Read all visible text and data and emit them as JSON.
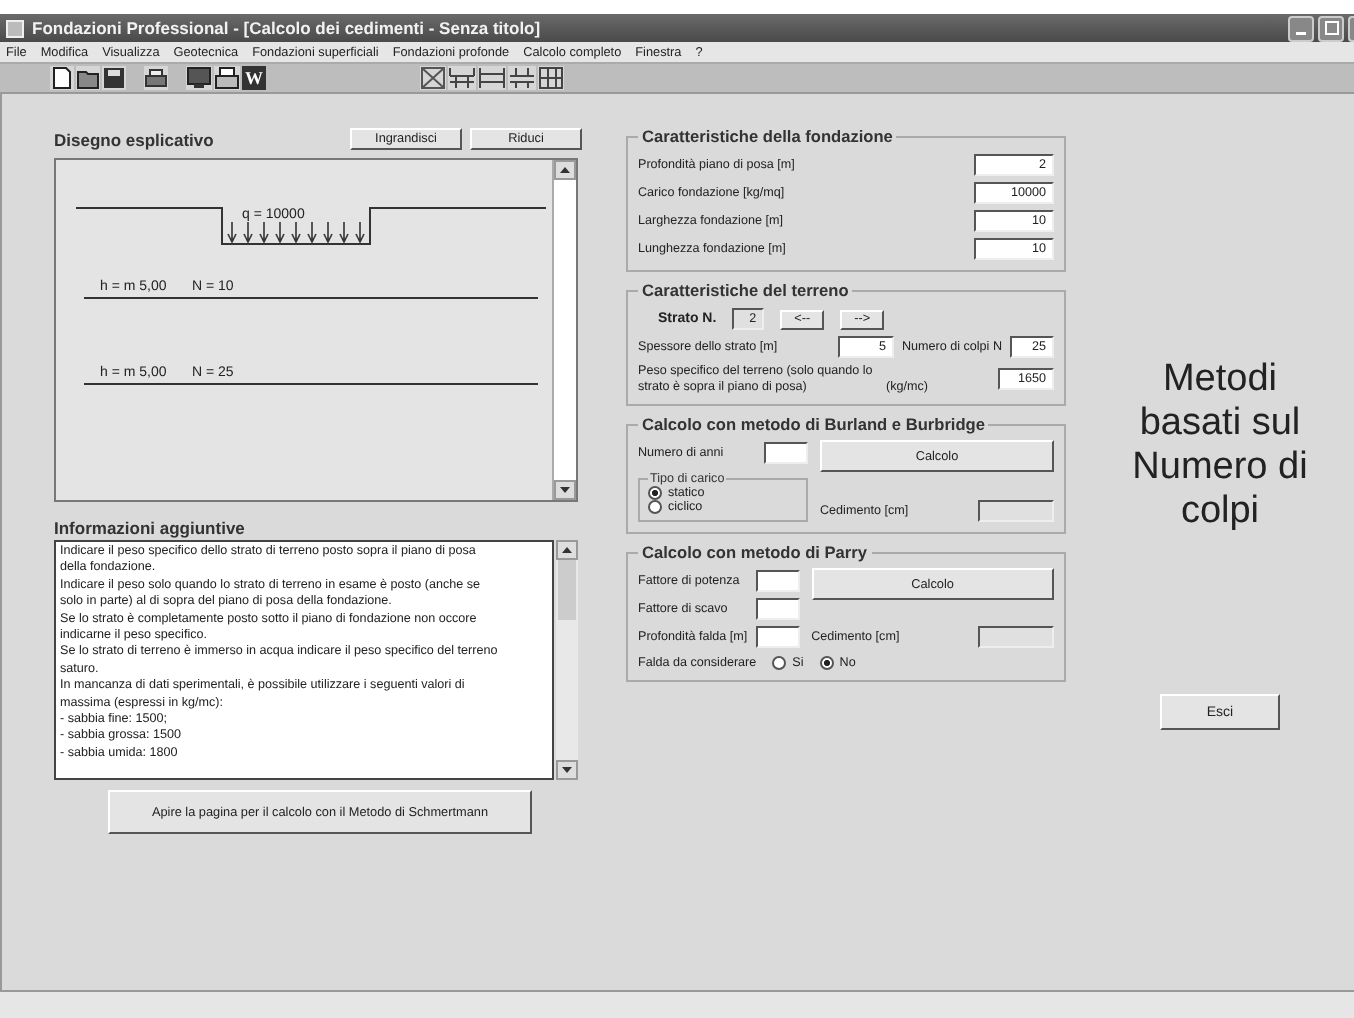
{
  "window": {
    "title": "Fondazioni Professional - [Calcolo dei cedimenti - Senza titolo]"
  },
  "menu": [
    "File",
    "Modifica",
    "Visualizza",
    "Geotecnica",
    "Fondazioni superficiali",
    "Fondazioni profonde",
    "Calcolo completo",
    "Finestra",
    "?"
  ],
  "toolbar": {
    "word_label": "W"
  },
  "drawing_panel": {
    "title": "Disegno esplicativo",
    "buttons": [
      "Ingrandisci",
      "Riduci"
    ],
    "load_label": "q = 10000",
    "layers": [
      {
        "thickness": "h = m 5,00",
        "blows": "N = 10"
      },
      {
        "thickness": "h = m 5,00",
        "blows": "N = 25"
      }
    ]
  },
  "info": {
    "title": "Informazioni aggiuntive",
    "lines": [
      "Indicare il peso specifico dello strato di terreno posto sopra il piano di posa",
      "della fondazione.",
      "Indicare il peso solo quando lo strato di terreno in esame è posto (anche se",
      "solo in parte) al di sopra del piano di posa della fondazione.",
      "Se lo strato è completamente posto sotto il piano di fondazione non occore",
      "indicarne il peso specifico.",
      "Se lo strato di terreno è immerso in acqua indicare il peso specifico del terreno",
      "saturo.",
      "In mancanza di dati sperimentali, è possibile utilizzare i seguenti valori di",
      "massima (espressi in kg/mc):",
      "- sabbia fine: 1500;",
      "- sabbia grossa: 1500",
      "- sabbia umida: 1800"
    ]
  },
  "schmertmann_button": "Apire la pagina per il calcolo con il Metodo di Schmertmann",
  "foundation": {
    "title": "Caratteristiche della fondazione",
    "fields": [
      {
        "label": "Profondità piano di posa [m]",
        "value": "2"
      },
      {
        "label": "Carico fondazione [kg/mq]",
        "value": "10000"
      },
      {
        "label": "Larghezza fondazione [m]",
        "value": "10"
      },
      {
        "label": "Lunghezza fondazione [m]",
        "value": "10"
      }
    ]
  },
  "soil": {
    "title": "Caratteristiche del terreno",
    "layer_label": "Strato N.",
    "layer_value": "2",
    "prev": "<--",
    "next": "-->",
    "thickness_label": "Spessore dello strato [m]",
    "thickness": "5",
    "blows_label": "Numero di colpi N",
    "blows": "25",
    "weight_label": "Peso specifico del terreno (solo quando lo strato è sopra il piano di posa)",
    "weight_unit": "(kg/mc)",
    "weight": "1650"
  },
  "burland": {
    "title": "Calcolo con metodo di Burland e Burbridge",
    "years_label": "Numero di anni",
    "button": "Calcolo",
    "load_type": {
      "title": "Tipo di carico",
      "options": [
        {
          "label": "statico",
          "selected": true
        },
        {
          "label": "ciclico",
          "selected": false
        }
      ]
    },
    "settlement_label": "Cedimento [cm]"
  },
  "parry": {
    "title": "Calcolo con metodo di Parry",
    "fields": [
      "Fattore di potenza",
      "Fattore di scavo",
      "Profondità falda [m]"
    ],
    "button": "Calcolo",
    "settlement_label": "Cedimento [cm]",
    "water_label": "Falda da considerare",
    "water_options": [
      {
        "label": "Si",
        "selected": false
      },
      {
        "label": "No",
        "selected": true
      }
    ]
  },
  "side_title": "Metodi basati sul Numero di colpi",
  "exit_button": "Esci"
}
